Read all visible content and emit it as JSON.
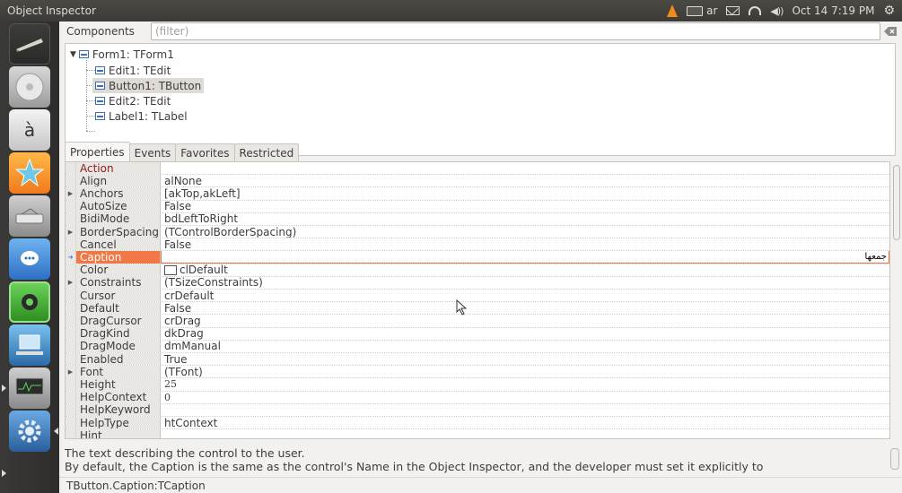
{
  "window": {
    "title": "Object Inspector"
  },
  "tray": {
    "keyboard": "ar",
    "datetime": "Oct 14  7:19 PM"
  },
  "components": {
    "label": "Components",
    "filter_placeholder": "(filter)"
  },
  "tree": {
    "root": "Form1: TForm1",
    "children": [
      "Edit1: TEdit",
      "Button1: TButton",
      "Edit2: TEdit",
      "Label1: TLabel"
    ],
    "selected_index": 1
  },
  "tabs": [
    "Properties",
    "Events",
    "Favorites",
    "Restricted"
  ],
  "active_tab": "Properties",
  "properties": [
    {
      "name": "Action",
      "value": ""
    },
    {
      "name": "Align",
      "value": "alNone"
    },
    {
      "name": "Anchors",
      "value": "[akTop,akLeft]",
      "expandable": true
    },
    {
      "name": "AutoSize",
      "value": "False"
    },
    {
      "name": "BidiMode",
      "value": "bdLeftToRight"
    },
    {
      "name": "BorderSpacing",
      "value": "(TControlBorderSpacing)",
      "expandable": true
    },
    {
      "name": "Cancel",
      "value": "False"
    },
    {
      "name": "Caption",
      "value": "جمعها"
    },
    {
      "name": "Color",
      "value": "clDefault"
    },
    {
      "name": "Constraints",
      "value": "(TSizeConstraints)",
      "expandable": true
    },
    {
      "name": "Cursor",
      "value": "crDefault"
    },
    {
      "name": "Default",
      "value": "False"
    },
    {
      "name": "DragCursor",
      "value": "crDrag"
    },
    {
      "name": "DragKind",
      "value": "dkDrag"
    },
    {
      "name": "DragMode",
      "value": "dmManual"
    },
    {
      "name": "Enabled",
      "value": "True"
    },
    {
      "name": "Font",
      "value": "(TFont)",
      "expandable": true
    },
    {
      "name": "Height",
      "value": "25"
    },
    {
      "name": "HelpContext",
      "value": "0"
    },
    {
      "name": "HelpKeyword",
      "value": ""
    },
    {
      "name": "HelpType",
      "value": "htContext"
    },
    {
      "name": "Hint",
      "value": ""
    }
  ],
  "selected_property": "Caption",
  "description": {
    "line1": "The text describing the control to the user.",
    "line2": "By default, the Caption is the same as the control's Name in the Object Inspector, and the developer must set it explicitly to"
  },
  "status": "TButton.Caption:TCaption",
  "colors": {
    "selected_row": "#f07746",
    "panel_bg": "#3c3b37",
    "launcher_bg": "#2e2d2b"
  }
}
